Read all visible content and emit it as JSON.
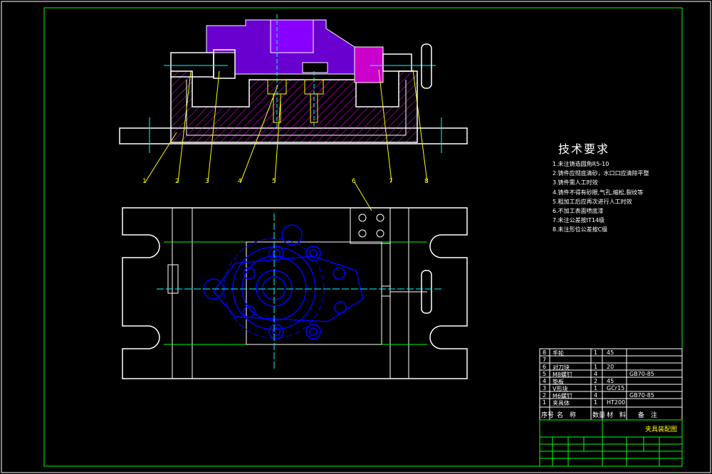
{
  "tech_requirements": {
    "title": "技术要求",
    "items": [
      "1.未注铸造圆角R5-10",
      "2.铸件应彻底清砂，水口口应清除平整",
      "3.铸件需人工时效",
      "4.铸件不得有砂眼,气孔,缩松,裂纹等",
      "5.粗加工后应再次进行人工时效",
      "6.不加工表面喷底漆",
      "7.未注公差按IT14级",
      "8.未注形位公差按C级"
    ]
  },
  "bom": {
    "rows": [
      {
        "no": "8",
        "name": "手轮",
        "qty": "1",
        "material": "45",
        "note": ""
      },
      {
        "no": "7",
        "name": "",
        "qty": "",
        "material": "",
        "note": ""
      },
      {
        "no": "6",
        "name": "对刀块",
        "qty": "1",
        "material": "20",
        "note": ""
      },
      {
        "no": "5",
        "name": "M8螺钉",
        "qty": "4",
        "material": "",
        "note": "GB70-85"
      },
      {
        "no": "4",
        "name": "垫板",
        "qty": "2",
        "material": "45",
        "note": ""
      },
      {
        "no": "3",
        "name": "V形块",
        "qty": "1",
        "material": "GCr15",
        "note": ""
      },
      {
        "no": "2",
        "name": "M6螺钉",
        "qty": "4",
        "material": "",
        "note": "GB70-85"
      },
      {
        "no": "1",
        "name": "夹具体",
        "qty": "1",
        "material": "HT200",
        "note": ""
      }
    ],
    "header": {
      "no": "序号",
      "name": "名　称",
      "qty": "数量",
      "material": "材　料",
      "note": "备　注"
    }
  },
  "title_block": {
    "drawing_name": "夹具装配图"
  },
  "balloons": [
    "1",
    "2",
    "3",
    "4",
    "5",
    "6",
    "7",
    "8"
  ],
  "colors": {
    "background": "#000000",
    "outline": "#ffffff",
    "yellow": "#ffff00",
    "blue": "#0000ff",
    "cyan": "#00ffff",
    "green": "#00ff00",
    "magenta": "#ff00ff",
    "purple": "#8800ff"
  }
}
